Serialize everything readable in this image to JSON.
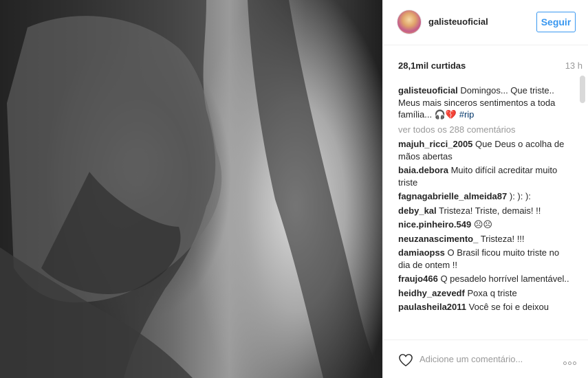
{
  "header": {
    "username": "galisteuoficial",
    "follow_label": "Seguir"
  },
  "stats": {
    "likes": "28,1mil curtidas",
    "time": "13 h"
  },
  "caption": {
    "user": "galisteuoficial",
    "text": "Domingos... Que triste.. Meus mais sinceros sentimentos a toda família... 🎧💔",
    "hashtag": "#rip"
  },
  "view_all": "ver todos os 288 comentários",
  "comments": [
    {
      "user": "majuh_ricci_2005",
      "text": "Que Deus o acolha de mãos abertas"
    },
    {
      "user": "baia.debora",
      "text": "Muito difícil acreditar muito triste"
    },
    {
      "user": "fagnagabrielle_almeida87",
      "text": "): ): ):"
    },
    {
      "user": "deby_kal",
      "text": "Tristeza! Triste, demais! !!"
    },
    {
      "user": "nice.pinheiro.549",
      "text": "☹☹"
    },
    {
      "user": "neuzanascimento_",
      "text": "Tristeza! !!!"
    },
    {
      "user": "damiaopss",
      "text": "O Brasil ficou muito triste no dia de ontem !!"
    },
    {
      "user": "fraujo466",
      "text": "Q pesadelo horrível lamentável.."
    },
    {
      "user": "heidhy_azevedf",
      "text": "Poxa q triste"
    },
    {
      "user": "paulasheila2011",
      "text": "Você se foi e deixou"
    }
  ],
  "footer": {
    "comment_placeholder": "Adicione um comentário...",
    "heart_icon": "heart-outline-icon",
    "more_icon": "more-options-icon"
  },
  "colors": {
    "accent": "#3897f0",
    "hashtag": "#003569",
    "muted": "#999999"
  }
}
